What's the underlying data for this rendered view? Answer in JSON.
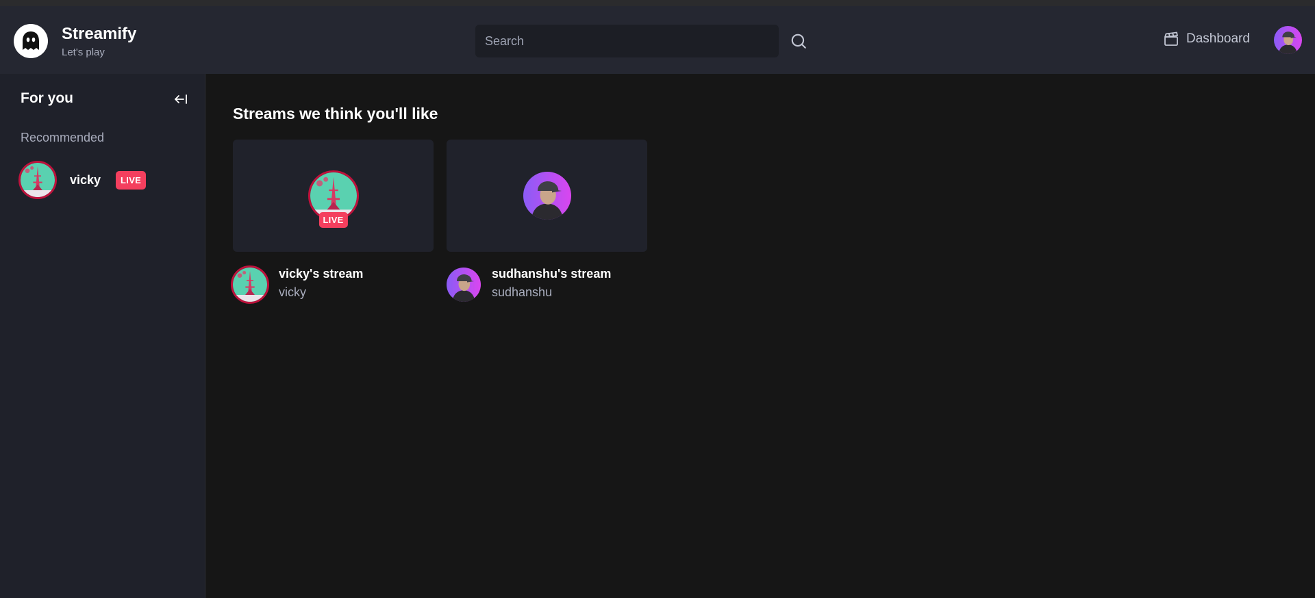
{
  "app": {
    "name": "Streamify",
    "tagline": "Let's play"
  },
  "search": {
    "placeholder": "Search",
    "value": ""
  },
  "nav": {
    "dashboard_label": "Dashboard"
  },
  "sidebar": {
    "heading": "For you",
    "section_label": "Recommended",
    "items": [
      {
        "name": "vicky",
        "badge": "LIVE"
      }
    ]
  },
  "main": {
    "title": "Streams we think you'll like",
    "streams": [
      {
        "title": "vicky's stream",
        "user": "vicky",
        "badge": "LIVE"
      },
      {
        "title": "sudhanshu's stream",
        "user": "sudhanshu"
      }
    ]
  },
  "colors": {
    "accent": "#f43f5e",
    "navbar": "#252731",
    "sidebar": "#1f212a",
    "background": "#161616"
  },
  "icons": [
    "ghost-logo-icon",
    "search-icon",
    "clapperboard-icon",
    "collapse-arrow-icon"
  ]
}
